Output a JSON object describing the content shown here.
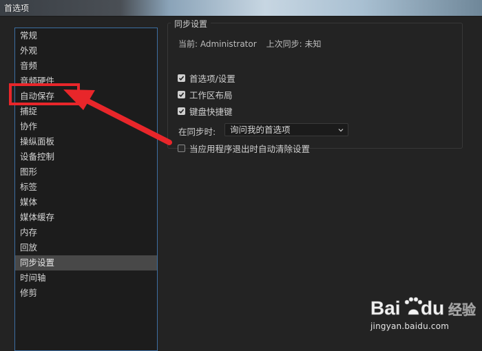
{
  "window": {
    "title": "首选项"
  },
  "sidebar": {
    "items": [
      {
        "label": "常规"
      },
      {
        "label": "外观"
      },
      {
        "label": "音频"
      },
      {
        "label": "音频硬件"
      },
      {
        "label": "自动保存"
      },
      {
        "label": "捕捉"
      },
      {
        "label": "协作"
      },
      {
        "label": "操纵面板"
      },
      {
        "label": "设备控制"
      },
      {
        "label": "图形"
      },
      {
        "label": "标签"
      },
      {
        "label": "媒体"
      },
      {
        "label": "媒体缓存"
      },
      {
        "label": "内存"
      },
      {
        "label": "回放"
      },
      {
        "label": "同步设置",
        "selected": true
      },
      {
        "label": "时间轴"
      },
      {
        "label": "修剪"
      }
    ]
  },
  "sync": {
    "legend": "同步设置",
    "current_label": "当前: Administrator",
    "last_sync_label": "上次同步: 未知",
    "options": [
      {
        "label": "首选项/设置",
        "checked": true
      },
      {
        "label": "工作区布局",
        "checked": true
      },
      {
        "label": "键盘快捷键",
        "checked": true
      }
    ],
    "on_sync_label": "在同步时:",
    "on_sync_value": "询问我的首选项",
    "clear_on_exit_label": "当应用程序退出时自动清除设置",
    "clear_on_exit_checked": false
  },
  "annotation": {
    "color": "#e8262a",
    "target": "自动保存"
  },
  "watermark": {
    "brand": "Bai",
    "brand_suffix": "du",
    "text": "经验",
    "url": "jingyan.baidu.com"
  }
}
